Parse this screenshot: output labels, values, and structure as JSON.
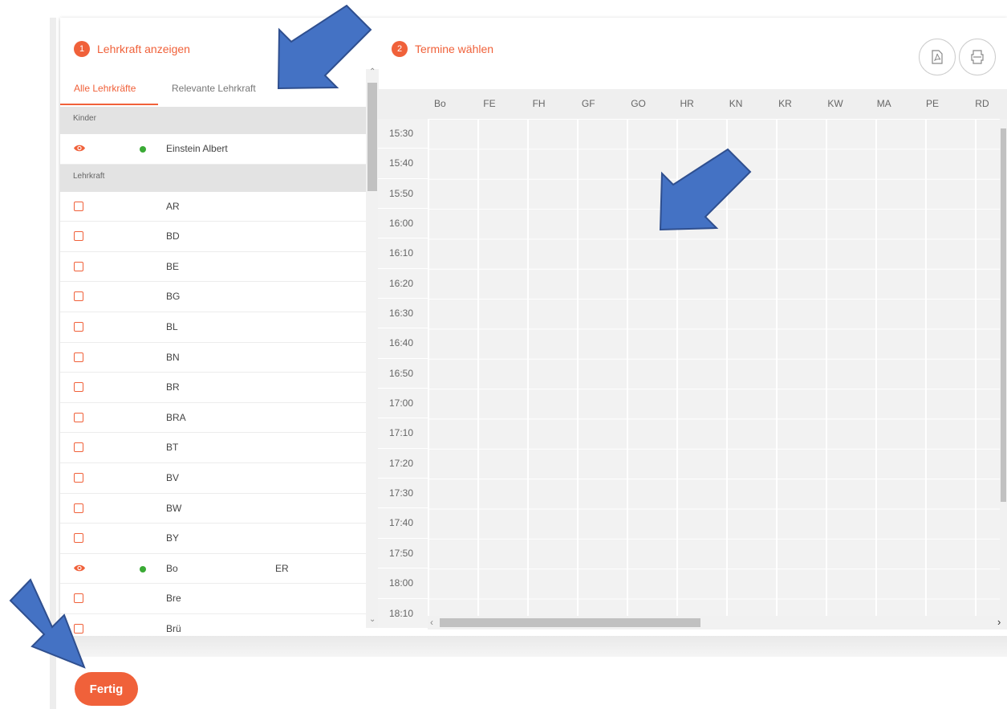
{
  "steps": {
    "step1": {
      "num": "1",
      "label": "Lehrkraft anzeigen"
    },
    "step2": {
      "num": "2",
      "label": "Termine wählen"
    }
  },
  "tabs": {
    "all": "Alle Lehrkräfte",
    "relevant": "Relevante Lehrkraft"
  },
  "list": {
    "section_children": "Kinder",
    "child": {
      "name": "Einstein Albert"
    },
    "section_teacher": "Lehrkraft",
    "teachers": [
      {
        "name": "AR",
        "extra": "",
        "visible": false
      },
      {
        "name": "BD",
        "extra": "",
        "visible": false
      },
      {
        "name": "BE",
        "extra": "",
        "visible": false
      },
      {
        "name": "BG",
        "extra": "",
        "visible": false
      },
      {
        "name": "BL",
        "extra": "",
        "visible": false
      },
      {
        "name": "BN",
        "extra": "",
        "visible": false
      },
      {
        "name": "BR",
        "extra": "",
        "visible": false
      },
      {
        "name": "BRA",
        "extra": "",
        "visible": false
      },
      {
        "name": "BT",
        "extra": "",
        "visible": false
      },
      {
        "name": "BV",
        "extra": "",
        "visible": false
      },
      {
        "name": "BW",
        "extra": "",
        "visible": false
      },
      {
        "name": "BY",
        "extra": "",
        "visible": false
      },
      {
        "name": "Bo",
        "extra": "ER",
        "visible": true
      },
      {
        "name": "Bre",
        "extra": "",
        "visible": false
      },
      {
        "name": "Brü",
        "extra": "",
        "visible": false
      }
    ]
  },
  "schedule": {
    "columns": [
      "Bo",
      "FE",
      "FH",
      "GF",
      "GO",
      "HR",
      "KN",
      "KR",
      "KW",
      "MA",
      "PE",
      "RD"
    ],
    "times": [
      "15:30",
      "15:40",
      "15:50",
      "16:00",
      "16:10",
      "16:20",
      "16:30",
      "16:40",
      "16:50",
      "17:00",
      "17:10",
      "17:20",
      "17:30",
      "17:40",
      "17:50",
      "18:00",
      "18:10"
    ]
  },
  "actions": {
    "done": "Fertig",
    "pdf_icon": "pdf-icon",
    "print_icon": "print-icon"
  },
  "colors": {
    "accent": "#f0613a",
    "online": "#3aaa35",
    "callout": "#4472c4"
  }
}
